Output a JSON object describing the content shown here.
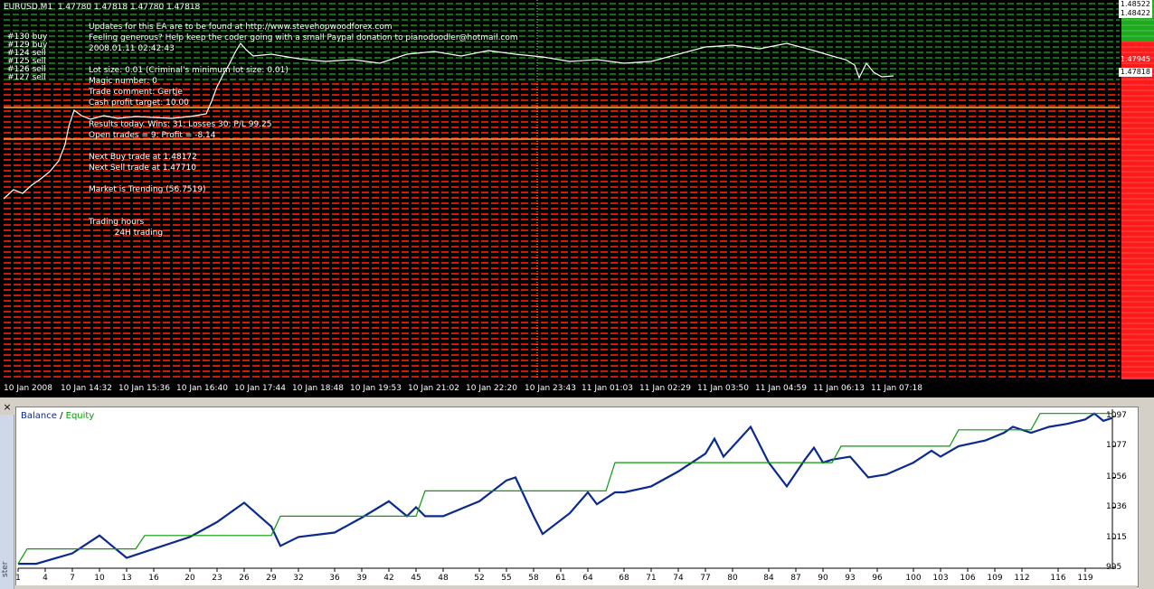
{
  "top_chart": {
    "header": "EURUSD,M1  1.47780 1.47818 1.47780 1.47818",
    "info_lines": [
      "Updates for this EA are to be found at http://www.stevehopwoodforex.com",
      "Feeling generous? Help keep the coder going with a small Paypal donation to pianodoodler@hotmail.com",
      "2008.01.11 02:42:43",
      "",
      "Lot size: 0.01 (Criminal's minimum lot size: 0.01)",
      "Magic number: 0",
      "Trade comment: Gertje",
      "Cash profit target: 10.00",
      "",
      "Results today. Wins: 31: Losses 30: P/L 99.25",
      "Open trades = 9: Profit = -8.14",
      "",
      "Next Buy trade at 1.48172",
      "Next Sell trade at 1.47710",
      "",
      "Market is Trending (56.7519)",
      "",
      "",
      "Trading hours",
      "          24H trading"
    ],
    "trade_tags": [
      "#130 buy",
      "#129 buy",
      "#124 sell",
      "#125 sell",
      "#126 sell",
      "#127 sell"
    ],
    "price_labels": [
      "1.48522",
      "1.48422",
      "1.47945",
      "1.47818"
    ],
    "x_ticks": [
      "10 Jan 2008",
      "10 Jan 14:32",
      "10 Jan 15:36",
      "10 Jan 16:40",
      "10 Jan 17:44",
      "10 Jan 18:48",
      "10 Jan 19:53",
      "10 Jan 21:02",
      "10 Jan 22:20",
      "10 Jan 23:43",
      "11 Jan 01:03",
      "11 Jan 02:29",
      "11 Jan 03:50",
      "11 Jan 04:59",
      "11 Jan 06:13",
      "11 Jan 07:18"
    ],
    "colors": {
      "background": "#000000",
      "buy_lines": "#22dd22",
      "sell_lines": "#cc1a00",
      "level_lines": "#ffaa33",
      "price": "#ffffff",
      "axis_strip": "#ff1a1a"
    }
  },
  "bottom_panel": {
    "close_label": "×",
    "side_label": "ster"
  },
  "chart_data": {
    "type": "line",
    "title": "",
    "legend": {
      "placement": "top-left",
      "separator": "/"
    },
    "x_ticks": [
      1,
      4,
      7,
      10,
      13,
      16,
      20,
      23,
      26,
      29,
      32,
      36,
      39,
      42,
      45,
      48,
      52,
      55,
      58,
      61,
      64,
      68,
      71,
      74,
      77,
      80,
      84,
      87,
      90,
      93,
      96,
      100,
      103,
      106,
      109,
      112,
      116,
      119
    ],
    "y_ticks": [
      995,
      1015,
      1036,
      1056,
      1077,
      1097
    ],
    "xlim": [
      1,
      122
    ],
    "ylim": [
      995,
      1097
    ],
    "grid": false,
    "series": [
      {
        "name": "Balance",
        "color": "#0b2a8f",
        "points": [
          [
            1,
            998
          ],
          [
            3,
            998
          ],
          [
            7,
            1005
          ],
          [
            10,
            1017
          ],
          [
            13,
            1002
          ],
          [
            16,
            1008
          ],
          [
            20,
            1016
          ],
          [
            23,
            1026
          ],
          [
            26,
            1039
          ],
          [
            29,
            1023
          ],
          [
            30,
            1010
          ],
          [
            32,
            1016
          ],
          [
            36,
            1019
          ],
          [
            39,
            1029
          ],
          [
            42,
            1040
          ],
          [
            44,
            1030
          ],
          [
            45,
            1036
          ],
          [
            46,
            1030
          ],
          [
            48,
            1030
          ],
          [
            52,
            1040
          ],
          [
            55,
            1054
          ],
          [
            56,
            1056
          ],
          [
            58,
            1030
          ],
          [
            59,
            1018
          ],
          [
            62,
            1032
          ],
          [
            64,
            1046
          ],
          [
            65,
            1038
          ],
          [
            67,
            1046
          ],
          [
            68,
            1046
          ],
          [
            71,
            1050
          ],
          [
            74,
            1060
          ],
          [
            77,
            1072
          ],
          [
            78,
            1082
          ],
          [
            79,
            1070
          ],
          [
            82,
            1090
          ],
          [
            84,
            1066
          ],
          [
            86,
            1050
          ],
          [
            88,
            1068
          ],
          [
            89,
            1076
          ],
          [
            90,
            1066
          ],
          [
            91,
            1068
          ],
          [
            93,
            1070
          ],
          [
            95,
            1056
          ],
          [
            97,
            1058
          ],
          [
            100,
            1066
          ],
          [
            102,
            1074
          ],
          [
            103,
            1070
          ],
          [
            105,
            1077
          ],
          [
            108,
            1081
          ],
          [
            110,
            1086
          ],
          [
            111,
            1090
          ],
          [
            113,
            1086
          ],
          [
            115,
            1090
          ],
          [
            117,
            1092
          ],
          [
            119,
            1095
          ],
          [
            120,
            1099
          ],
          [
            121,
            1094
          ],
          [
            122,
            1096
          ]
        ]
      },
      {
        "name": "Equity",
        "color": "#0a9a0a",
        "points": [
          [
            1,
            998
          ],
          [
            2,
            1008
          ],
          [
            14,
            1008
          ],
          [
            15,
            1017
          ],
          [
            29,
            1017
          ],
          [
            30,
            1030
          ],
          [
            45,
            1030
          ],
          [
            46,
            1047
          ],
          [
            66,
            1047
          ],
          [
            67,
            1066
          ],
          [
            91,
            1066
          ],
          [
            92,
            1077
          ],
          [
            104,
            1077
          ],
          [
            105,
            1088
          ],
          [
            113,
            1088
          ],
          [
            114,
            1099
          ],
          [
            122,
            1099
          ]
        ]
      }
    ]
  }
}
